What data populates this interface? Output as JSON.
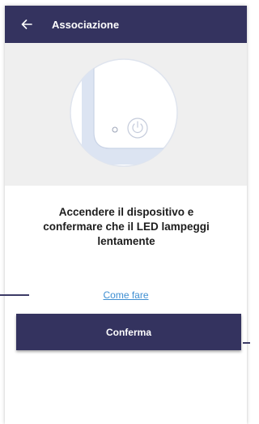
{
  "header": {
    "title": "Associazione",
    "back_icon": "arrow-left-icon"
  },
  "illustration": {
    "device_icon": "power-icon",
    "led_icon": "led-indicator-icon"
  },
  "main": {
    "instruction_line1": "Accendere il dispositivo e",
    "instruction_line2": "confermare che il LED lampeggi",
    "instruction_line3": "lentamente",
    "help_link": "Come fare",
    "confirm_label": "Conferma"
  },
  "colors": {
    "primary": "#34335f",
    "link": "#3f8fd2",
    "hero_bg": "#efefef"
  }
}
